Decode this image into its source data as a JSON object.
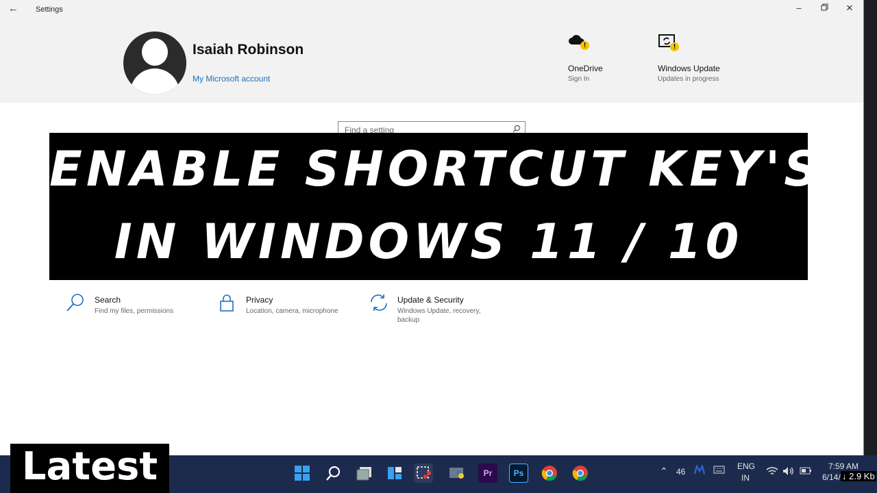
{
  "window": {
    "title": "Settings",
    "back_icon": "back-arrow-icon",
    "controls": [
      "minimize-icon",
      "restore-icon",
      "close-icon"
    ]
  },
  "header": {
    "user_name": "Isaiah Robinson",
    "account_link": "My Microsoft account",
    "onedrive": {
      "name": "OneDrive",
      "status": "Sign In"
    },
    "windows_update": {
      "name": "Windows Update",
      "status": "Updates in progress"
    }
  },
  "search": {
    "placeholder": "Find a setting"
  },
  "banner": {
    "line1": "ENABLE SHORTCUT KEY'S",
    "line2": "IN WINDOWS 11 / 10"
  },
  "categories": [
    {
      "name": "Search",
      "desc": "Find my files, permissions",
      "icon": "search-icon"
    },
    {
      "name": "Privacy",
      "desc": "Location, camera, microphone",
      "icon": "lock-icon"
    },
    {
      "name": "Update & Security",
      "desc": "Windows Update, recovery, backup",
      "icon": "sync-icon"
    }
  ],
  "badge": {
    "text": "Latest"
  },
  "taskbar": {
    "apps": [
      "windows-start-icon",
      "search-icon",
      "task-view-icon",
      "widgets-icon",
      "snipping-tool-icon",
      "python-icon",
      "premiere-pro-icon",
      "photoshop-icon",
      "chrome-icon",
      "chrome-icon"
    ],
    "premiere_label": "Pr",
    "photoshop_label": "Ps",
    "tray": {
      "count": "46",
      "lang_top": "ENG",
      "lang_bottom": "IN",
      "time": "7:59 AM",
      "date": "6/14/",
      "net_speed": "↓ 2.9 Kb"
    }
  },
  "colors": {
    "accent": "#1a6fc4",
    "taskbar": "#1c2b4d",
    "warning": "#f5c400",
    "banner_bg": "#000000"
  }
}
